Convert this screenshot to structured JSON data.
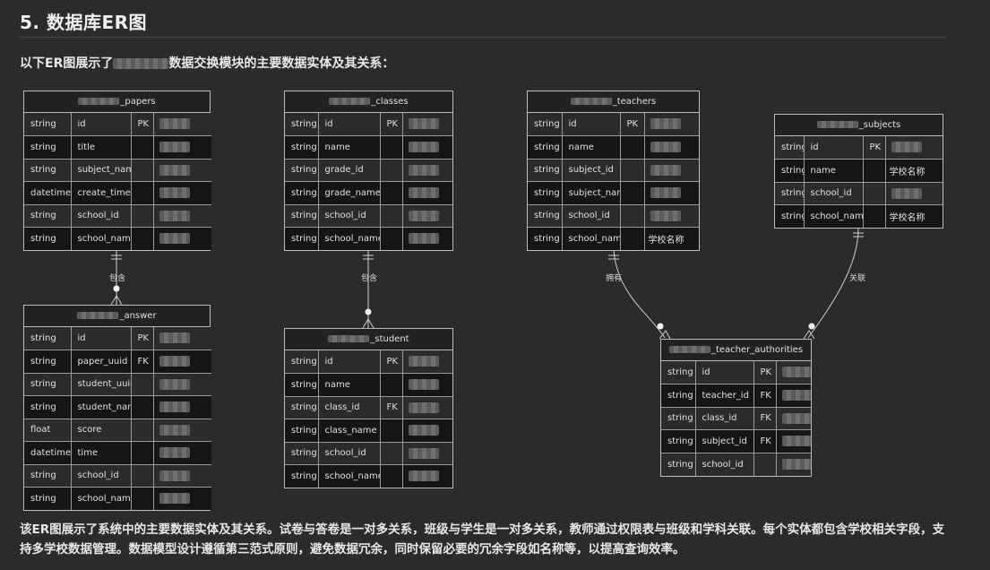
{
  "heading": "5. 数据库ER图",
  "intro": {
    "before": "以下ER图展示了",
    "after": "数据交换模块的主要数据实体及其关系："
  },
  "entities": [
    {
      "id": "papers",
      "name": "_papers",
      "rows": [
        [
          "string",
          "id",
          "PK"
        ],
        [
          "string",
          "title",
          ""
        ],
        [
          "string",
          "subject_name",
          ""
        ],
        [
          "datetime",
          "create_time",
          ""
        ],
        [
          "string",
          "school_id",
          ""
        ],
        [
          "string",
          "school_name",
          ""
        ]
      ]
    },
    {
      "id": "classes",
      "name": "_classes",
      "rows": [
        [
          "string",
          "id",
          "PK"
        ],
        [
          "string",
          "name",
          ""
        ],
        [
          "string",
          "grade_id",
          ""
        ],
        [
          "string",
          "grade_name",
          ""
        ],
        [
          "string",
          "school_id",
          ""
        ],
        [
          "string",
          "school_name",
          ""
        ]
      ]
    },
    {
      "id": "teachers",
      "name": "_teachers",
      "rows": [
        [
          "string",
          "id",
          "PK"
        ],
        [
          "string",
          "name",
          ""
        ],
        [
          "string",
          "subject_id",
          ""
        ],
        [
          "string",
          "subject_name",
          ""
        ],
        [
          "string",
          "school_id",
          ""
        ],
        [
          "string",
          "school_name",
          ""
        ]
      ]
    },
    {
      "id": "subjects",
      "name": "_subjects",
      "rows": [
        [
          "string",
          "id",
          "PK"
        ],
        [
          "string",
          "name",
          ""
        ],
        [
          "string",
          "school_id",
          ""
        ],
        [
          "string",
          "school_name",
          ""
        ]
      ]
    },
    {
      "id": "answer",
      "name": "_answer",
      "rows": [
        [
          "string",
          "id",
          "PK"
        ],
        [
          "string",
          "paper_uuid",
          "FK"
        ],
        [
          "string",
          "student_uuid",
          ""
        ],
        [
          "string",
          "student_name",
          ""
        ],
        [
          "float",
          "score",
          ""
        ],
        [
          "datetime",
          "time",
          ""
        ],
        [
          "string",
          "school_id",
          ""
        ],
        [
          "string",
          "school_name",
          ""
        ]
      ]
    },
    {
      "id": "student",
      "name": "_student",
      "rows": [
        [
          "string",
          "id",
          "PK"
        ],
        [
          "string",
          "name",
          ""
        ],
        [
          "string",
          "class_id",
          "FK"
        ],
        [
          "string",
          "class_name",
          ""
        ],
        [
          "string",
          "school_id",
          ""
        ],
        [
          "string",
          "school_name",
          ""
        ]
      ]
    },
    {
      "id": "teacher_authorities",
      "name": "_teacher_authorities",
      "rows": [
        [
          "string",
          "id",
          "PK"
        ],
        [
          "string",
          "teacher_id",
          "FK"
        ],
        [
          "string",
          "class_id",
          "FK"
        ],
        [
          "string",
          "subject_id",
          "FK"
        ],
        [
          "string",
          "school_id",
          ""
        ]
      ]
    }
  ],
  "relationships": [
    {
      "from": "papers",
      "to": "answer",
      "label": "包含"
    },
    {
      "from": "classes",
      "to": "student",
      "label": "包含"
    },
    {
      "from": "teachers",
      "to": "teacher_authorities",
      "label": "拥有"
    },
    {
      "from": "subjects",
      "to": "teacher_authorities",
      "label": "关联"
    }
  ],
  "visible_comments": {
    "subjects": [
      "",
      "学校名称",
      "",
      "学校名称"
    ],
    "teachers": [
      "",
      "",
      "",
      "",
      "",
      "学校名称"
    ]
  },
  "summary": "该ER图展示了系统中的主要数据实体及其关系。试卷与答卷是一对多关系，班级与学生是一对多关系，教师通过权限表与班级和学科关联。每个实体都包含学校相关字段，支持多学校数据管理。数据模型设计遵循第三范式原则，避免数据冗余，同时保留必要的冗余字段如名称等，以提高查询效率。",
  "colors": {
    "background": "#2b2b2b",
    "line": "#cfcfcf",
    "text": "#e6e6e6"
  }
}
